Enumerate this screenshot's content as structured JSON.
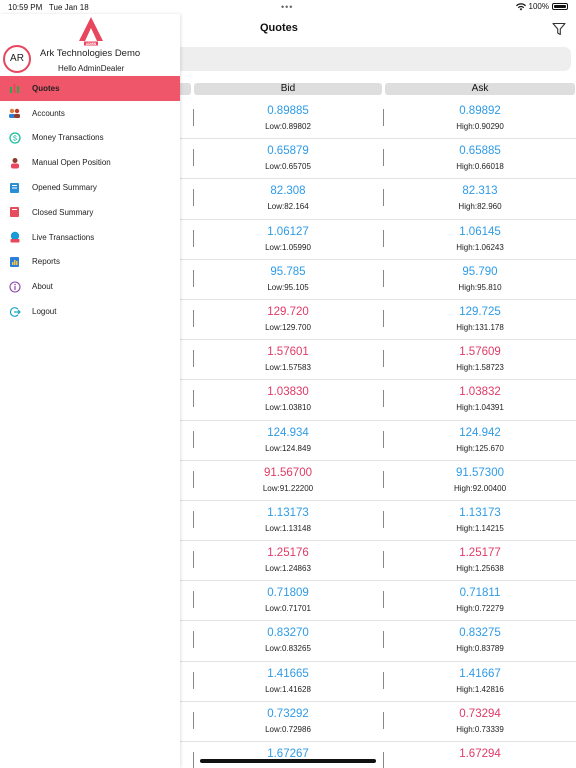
{
  "status_bar": {
    "time": "10:59 PM",
    "date": "Tue Jan 18",
    "battery": "100%"
  },
  "header": {
    "title": "Quotes",
    "filter_icon": "filter-icon"
  },
  "columns": {
    "bid": "Bid",
    "ask": "Ask"
  },
  "quotes": [
    {
      "bid": "0.89885",
      "bid_sub": "Low:0.89802",
      "ask": "0.89892",
      "ask_sub": "High:0.90290",
      "bid_dir": "up",
      "ask_dir": "up"
    },
    {
      "bid": "0.65879",
      "bid_sub": "Low:0.65705",
      "ask": "0.65885",
      "ask_sub": "High:0.66018",
      "bid_dir": "up",
      "ask_dir": "up"
    },
    {
      "bid": "82.308",
      "bid_sub": "Low:82.164",
      "ask": "82.313",
      "ask_sub": "High:82.960",
      "bid_dir": "up",
      "ask_dir": "up"
    },
    {
      "bid": "1.06127",
      "bid_sub": "Low:1.05990",
      "ask": "1.06145",
      "ask_sub": "High:1.06243",
      "bid_dir": "up",
      "ask_dir": "up"
    },
    {
      "bid": "95.785",
      "bid_sub": "Low:95.105",
      "ask": "95.790",
      "ask_sub": "High:95.810",
      "bid_dir": "up",
      "ask_dir": "up"
    },
    {
      "bid": "129.720",
      "bid_sub": "Low:129.700",
      "ask": "129.725",
      "ask_sub": "High:131.178",
      "bid_dir": "down",
      "ask_dir": "up"
    },
    {
      "bid": "1.57601",
      "bid_sub": "Low:1.57583",
      "ask": "1.57609",
      "ask_sub": "High:1.58723",
      "bid_dir": "down",
      "ask_dir": "down"
    },
    {
      "bid": "1.03830",
      "bid_sub": "Low:1.03810",
      "ask": "1.03832",
      "ask_sub": "High:1.04391",
      "bid_dir": "down",
      "ask_dir": "down"
    },
    {
      "bid": "124.934",
      "bid_sub": "Low:124.849",
      "ask": "124.942",
      "ask_sub": "High:125.670",
      "bid_dir": "up",
      "ask_dir": "up"
    },
    {
      "bid": "91.56700",
      "bid_sub": "Low:91.22200",
      "ask": "91.57300",
      "ask_sub": "High:92.00400",
      "bid_dir": "down",
      "ask_dir": "up"
    },
    {
      "bid": "1.13173",
      "bid_sub": "Low:1.13148",
      "ask": "1.13173",
      "ask_sub": "High:1.14215",
      "bid_dir": "up",
      "ask_dir": "up"
    },
    {
      "bid": "1.25176",
      "bid_sub": "Low:1.24863",
      "ask": "1.25177",
      "ask_sub": "High:1.25638",
      "bid_dir": "down",
      "ask_dir": "down"
    },
    {
      "bid": "0.71809",
      "bid_sub": "Low:0.71701",
      "ask": "0.71811",
      "ask_sub": "High:0.72279",
      "bid_dir": "up",
      "ask_dir": "up"
    },
    {
      "bid": "0.83270",
      "bid_sub": "Low:0.83265",
      "ask": "0.83275",
      "ask_sub": "High:0.83789",
      "bid_dir": "up",
      "ask_dir": "up"
    },
    {
      "bid": "1.41665",
      "bid_sub": "Low:1.41628",
      "ask": "1.41667",
      "ask_sub": "High:1.42816",
      "bid_dir": "up",
      "ask_dir": "up"
    },
    {
      "bid": "0.73292",
      "bid_sub": "Low:0.72986",
      "ask": "0.73294",
      "ask_sub": "High:0.73339",
      "bid_dir": "up",
      "ask_dir": "down"
    },
    {
      "bid": "1.67267",
      "bid_sub": "",
      "ask": "1.67294",
      "ask_sub": "",
      "bid_dir": "up",
      "ask_dir": "down"
    }
  ],
  "sidebar": {
    "logo_text": "ADMIN",
    "avatar_initials": "AR",
    "company": "Ark Technologies Demo",
    "greeting": "Hello AdminDealer",
    "items": [
      {
        "label": "Quotes",
        "icon": "quotes-icon",
        "color": "#2aa84a",
        "active": true
      },
      {
        "label": "Accounts",
        "icon": "accounts-icon",
        "color": "#c0392b"
      },
      {
        "label": "Money Transactions",
        "icon": "money-transactions-icon",
        "color": "#1abc9c"
      },
      {
        "label": "Manual Open Position",
        "icon": "manual-open-position-icon",
        "color": "#8e3b2e"
      },
      {
        "label": "Opened Summary",
        "icon": "opened-summary-icon",
        "color": "#2b8fd6"
      },
      {
        "label": "Closed Summary",
        "icon": "closed-summary-icon",
        "color": "#e74c5c"
      },
      {
        "label": "Live Transactions",
        "icon": "live-transactions-icon",
        "color": "#1a9bd7"
      },
      {
        "label": "Reports",
        "icon": "reports-icon",
        "color": "#2b7fd6"
      },
      {
        "label": "About",
        "icon": "about-icon",
        "color": "#8e44ad"
      },
      {
        "label": "Logout",
        "icon": "logout-icon",
        "color": "#1aa3c7"
      }
    ]
  },
  "colors": {
    "accent": "#f0566a",
    "up": "#2e9be6",
    "down": "#e03a67"
  }
}
